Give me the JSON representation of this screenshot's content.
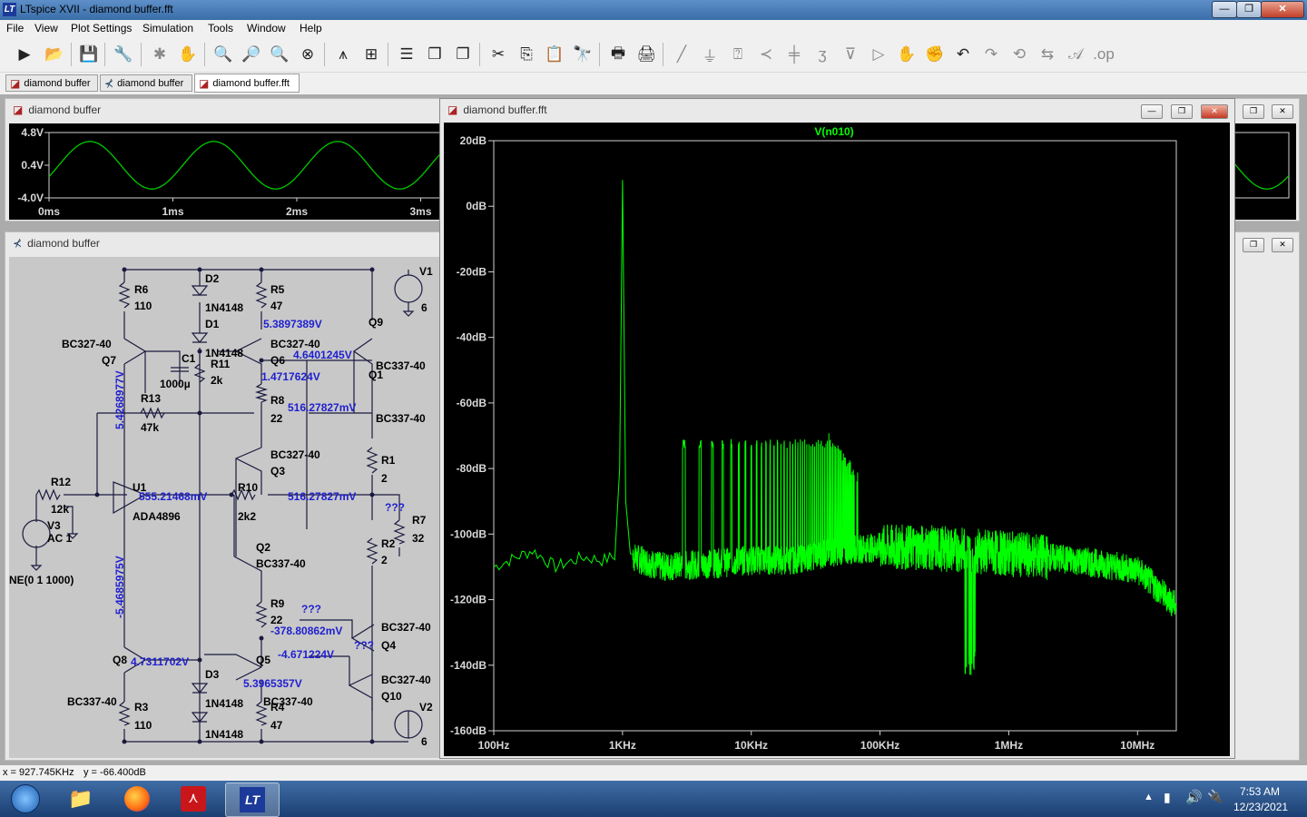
{
  "app": {
    "title": "LTspice XVII - diamond buffer.fft",
    "menu": [
      "File",
      "View",
      "Plot Settings",
      "Simulation",
      "Tools",
      "Window",
      "Help"
    ],
    "window_buttons": {
      "minimize": "—",
      "maximize": "❐",
      "close": "✕"
    }
  },
  "tabs": [
    {
      "label": "diamond buffer",
      "icon": "waveform-icon"
    },
    {
      "label": "diamond buffer",
      "icon": "schematic-icon"
    },
    {
      "label": "diamond buffer.fft",
      "icon": "waveform-icon"
    }
  ],
  "transient_window": {
    "title": "diamond buffer",
    "y_ticks": [
      "4.8V",
      "0.4V",
      "-4.0V"
    ],
    "x_ticks": [
      "0ms",
      "1ms",
      "2ms",
      "3ms"
    ]
  },
  "schematic_window": {
    "title": "diamond buffer",
    "labels": {
      "V1": "V1",
      "V1v": "6",
      "V2": "V2",
      "V2v": "6",
      "V3": "V3",
      "V3ac": "AC 1",
      "sine": "NE(0 1 1000)",
      "R6": "R6",
      "R6v": "110",
      "R5": "R5",
      "R5v": "47",
      "R3": "R3",
      "R3v": "110",
      "R4": "R4",
      "R4v": "47",
      "R11": "R11",
      "R11v": "2k",
      "R13": "R13",
      "R13v": "47k",
      "R12": "R12",
      "R12v": "12k",
      "R8": "R8",
      "R8v": "22",
      "R9": "R9",
      "R9v": "22",
      "R10": "R10",
      "R10v": "2k2",
      "R1": "R1",
      "R1v": "2",
      "R2": "R2",
      "R2v": "2",
      "R7": "R7",
      "R7v": "32",
      "C1": "C1",
      "C1v": "1000µ",
      "D1": "D1",
      "D1v": "1N4148",
      "D2": "D2",
      "D2v": "1N4148",
      "D3": "D3",
      "D3v": "1N4148",
      "D4v": "1N4148",
      "Q7": "Q7",
      "Q7m": "BC327-40",
      "Q6": "Q6",
      "Q6m": "BC327-40",
      "Q9": "Q9",
      "Q1": "Q1",
      "Q1m": "BC337-40",
      "Q9m": "BC337-40",
      "Q3": "Q3",
      "Q3m": "BC327-40",
      "Q2": "Q2",
      "Q2m": "BC337-40",
      "Q5": "Q5",
      "Q5m": "BC337-40",
      "Q8": "Q8",
      "Q8m": "BC337-40",
      "Q4": "Q4",
      "Q4m": "BC327-40",
      "Q10": "Q10",
      "Q10m": "BC327-40",
      "U1": "U1",
      "U1m": "ADA4896",
      "n1": "5.3897389V",
      "n2": "4.6401245V",
      "n3": "1.4717624V",
      "n4": "516.27827mV",
      "n5": "516.27827mV",
      "n6": "555.21468mV",
      "n7": "-378.80862mV",
      "n8": "-4.671224V",
      "n9": "4.7311702V",
      "n10": "5.3965357V",
      "n11": "5.4268977V",
      "n12": "-5.4685975V",
      "q1": "???",
      "q2": "???",
      "q3": "???"
    }
  },
  "fft_window": {
    "title": "diamond buffer.fft",
    "trace_label": "V(n010)",
    "y_ticks": [
      "20dB",
      "0dB",
      "-20dB",
      "-40dB",
      "-60dB",
      "-80dB",
      "-100dB",
      "-120dB",
      "-140dB",
      "-160dB"
    ],
    "x_ticks": [
      "100Hz",
      "1KHz",
      "10KHz",
      "100KHz",
      "1MHz",
      "10MHz"
    ]
  },
  "chart_data": [
    {
      "type": "line",
      "title": "",
      "xlabel": "",
      "ylabel": "",
      "x_scale": "log",
      "xlim": [
        100,
        20000000
      ],
      "ylim": [
        -160,
        20
      ],
      "grid": false,
      "series": [
        {
          "name": "V(n010)",
          "color": "#00ff00",
          "noise_floor": {
            "x": [
              100,
              200,
              300,
              500,
              700,
              1000,
              2000,
              5000,
              10000,
              20000,
              50000,
              100000,
              200000,
              500000,
              1000000,
              2000000,
              5000000,
              10000000,
              20000000
            ],
            "y": [
              -110,
              -105,
              -110,
              -107,
              -108,
              -106,
              -110,
              -109,
              -108,
              -108,
              -105,
              -104,
              -104,
              -105,
              -106,
              -107,
              -109,
              -111,
              -122
            ]
          },
          "fundamental": {
            "x": 1000,
            "y": 8
          },
          "harmonics_peak_db": -73,
          "harmonics_range_hz": [
            3000,
            40000
          ],
          "notch": {
            "x": 500000,
            "y": -143
          }
        }
      ]
    },
    {
      "type": "line",
      "x_unit": "ms",
      "y_unit": "V",
      "xlim": [
        0,
        3.2
      ],
      "ylim": [
        -4.0,
        4.8
      ],
      "series": [
        {
          "name": "",
          "color": "#00c800",
          "amplitude": 3.2,
          "offset": 0.4,
          "frequency_khz": 1
        }
      ]
    }
  ],
  "status": {
    "x": "x = 927.745KHz",
    "y": "y = -66.400dB"
  },
  "taskbar": {
    "time": "7:53 AM",
    "date": "12/23/2021"
  }
}
